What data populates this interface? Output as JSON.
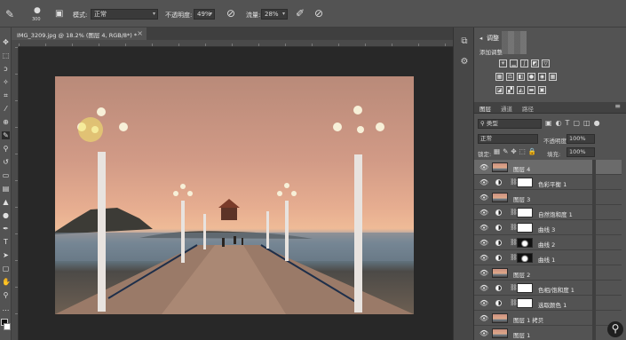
{
  "options_bar": {
    "brush_size": "300",
    "mode_label": "模式:",
    "mode_value": "正常",
    "opacity_label": "不透明度:",
    "opacity_value": "49%",
    "flow_label": "流量:",
    "flow_value": "28%"
  },
  "document": {
    "tab_title": "IMG_3209.jpg @ 18.2% (图层 4, RGB/8*) *"
  },
  "adjustments": {
    "title": "调整",
    "hint": "添加调整"
  },
  "layers_panel": {
    "tabs": [
      "图层",
      "通道",
      "路径"
    ],
    "filter_kind": "类型",
    "blend_mode": "正常",
    "opacity_label": "不透明度:",
    "opacity_value": "100%",
    "lock_label": "锁定:",
    "fill_label": "填充:",
    "fill_value": "100%",
    "layers": [
      {
        "name": "图层 4",
        "kind": "pixel",
        "selected": true
      },
      {
        "name": "色彩平衡 1",
        "kind": "adjustment"
      },
      {
        "name": "图层 3",
        "kind": "pixel"
      },
      {
        "name": "自然饱和度 1",
        "kind": "adjustment"
      },
      {
        "name": "曲线 3",
        "kind": "adjustment"
      },
      {
        "name": "曲线 2",
        "kind": "adjustment",
        "dark_mask": true
      },
      {
        "name": "曲线 1",
        "kind": "adjustment",
        "dark_mask": true
      },
      {
        "name": "图层 2",
        "kind": "pixel"
      },
      {
        "name": "色相/饱和度 1",
        "kind": "adjustment"
      },
      {
        "name": "选取颜色 1",
        "kind": "adjustment"
      },
      {
        "name": "图层 1 拷贝",
        "kind": "pixel"
      },
      {
        "name": "图层 1",
        "kind": "pixel"
      }
    ]
  },
  "colors": {
    "ui_background": "#535353",
    "workspace": "#282828",
    "selected_layer": "#6b6b6b"
  }
}
